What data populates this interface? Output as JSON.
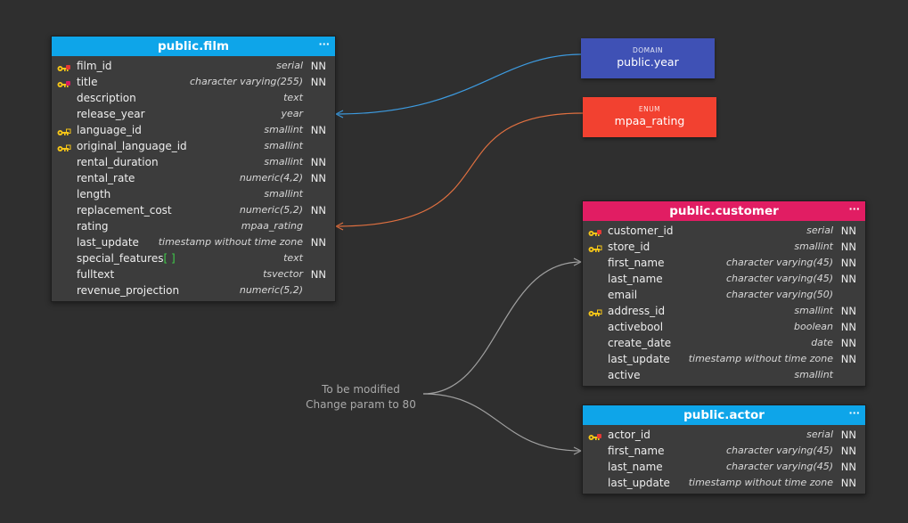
{
  "colors": {
    "film_header": "#0ea5e9",
    "customer_header": "#e11d63",
    "actor_header": "#0ea5e9",
    "domain_note": "#3f51b5",
    "enum_note": "#f24130",
    "link_domain": "#3d9be0",
    "link_enum": "#e07040",
    "link_comment": "#a0a0a0",
    "pk_key": "#f5c518",
    "pk_dot": "#e53935",
    "fk_key": "#f5c518",
    "unique_dot": "#d81b60"
  },
  "header_menu_icon": "···",
  "tables": {
    "film": {
      "title": "public.film",
      "columns": [
        {
          "name": "film_id",
          "type": "serial",
          "nn": "NN",
          "key": "pk"
        },
        {
          "name": "title",
          "type": "character varying(255)",
          "nn": "NN",
          "key": "unique"
        },
        {
          "name": "description",
          "type": "text",
          "nn": "",
          "key": ""
        },
        {
          "name": "release_year",
          "type": "year",
          "nn": "",
          "key": ""
        },
        {
          "name": "language_id",
          "type": "smallint",
          "nn": "NN",
          "key": "fk"
        },
        {
          "name": "original_language_id",
          "type": "smallint",
          "nn": "",
          "key": "fk"
        },
        {
          "name": "rental_duration",
          "type": "smallint",
          "nn": "NN",
          "key": ""
        },
        {
          "name": "rental_rate",
          "type": "numeric(4,2)",
          "nn": "NN",
          "key": ""
        },
        {
          "name": "length",
          "type": "smallint",
          "nn": "",
          "key": ""
        },
        {
          "name": "replacement_cost",
          "type": "numeric(5,2)",
          "nn": "NN",
          "key": ""
        },
        {
          "name": "rating",
          "type": "mpaa_rating",
          "nn": "",
          "key": ""
        },
        {
          "name": "last_update",
          "type": "timestamp without time zone",
          "nn": "NN",
          "key": ""
        },
        {
          "name": "special_features",
          "array_suffix": "[ ]",
          "type": "text",
          "nn": "",
          "key": ""
        },
        {
          "name": "fulltext",
          "type": "tsvector",
          "nn": "NN",
          "key": ""
        },
        {
          "name": "revenue_projection",
          "type": "numeric(5,2)",
          "nn": "",
          "key": ""
        }
      ]
    },
    "customer": {
      "title": "public.customer",
      "columns": [
        {
          "name": "customer_id",
          "type": "serial",
          "nn": "NN",
          "key": "pk"
        },
        {
          "name": "store_id",
          "type": "smallint",
          "nn": "NN",
          "key": "fk"
        },
        {
          "name": "first_name",
          "type": "character varying(45)",
          "nn": "NN",
          "key": ""
        },
        {
          "name": "last_name",
          "type": "character varying(45)",
          "nn": "NN",
          "key": ""
        },
        {
          "name": "email",
          "type": "character varying(50)",
          "nn": "",
          "key": ""
        },
        {
          "name": "address_id",
          "type": "smallint",
          "nn": "NN",
          "key": "fk"
        },
        {
          "name": "activebool",
          "type": "boolean",
          "nn": "NN",
          "key": ""
        },
        {
          "name": "create_date",
          "type": "date",
          "nn": "NN",
          "key": ""
        },
        {
          "name": "last_update",
          "type": "timestamp without time zone",
          "nn": "NN",
          "key": ""
        },
        {
          "name": "active",
          "type": "smallint",
          "nn": "",
          "key": ""
        }
      ]
    },
    "actor": {
      "title": "public.actor",
      "columns": [
        {
          "name": "actor_id",
          "type": "serial",
          "nn": "NN",
          "key": "pk"
        },
        {
          "name": "first_name",
          "type": "character varying(45)",
          "nn": "NN",
          "key": ""
        },
        {
          "name": "last_name",
          "type": "character varying(45)",
          "nn": "NN",
          "key": ""
        },
        {
          "name": "last_update",
          "type": "timestamp without time zone",
          "nn": "NN",
          "key": ""
        }
      ]
    }
  },
  "notes": {
    "domain": {
      "kind": "DOMAIN",
      "name": "public.year"
    },
    "enum": {
      "kind": "ENUM",
      "name": "mpaa_rating"
    }
  },
  "comment": {
    "line1": "To be modified",
    "line2": "Change param to 80"
  }
}
